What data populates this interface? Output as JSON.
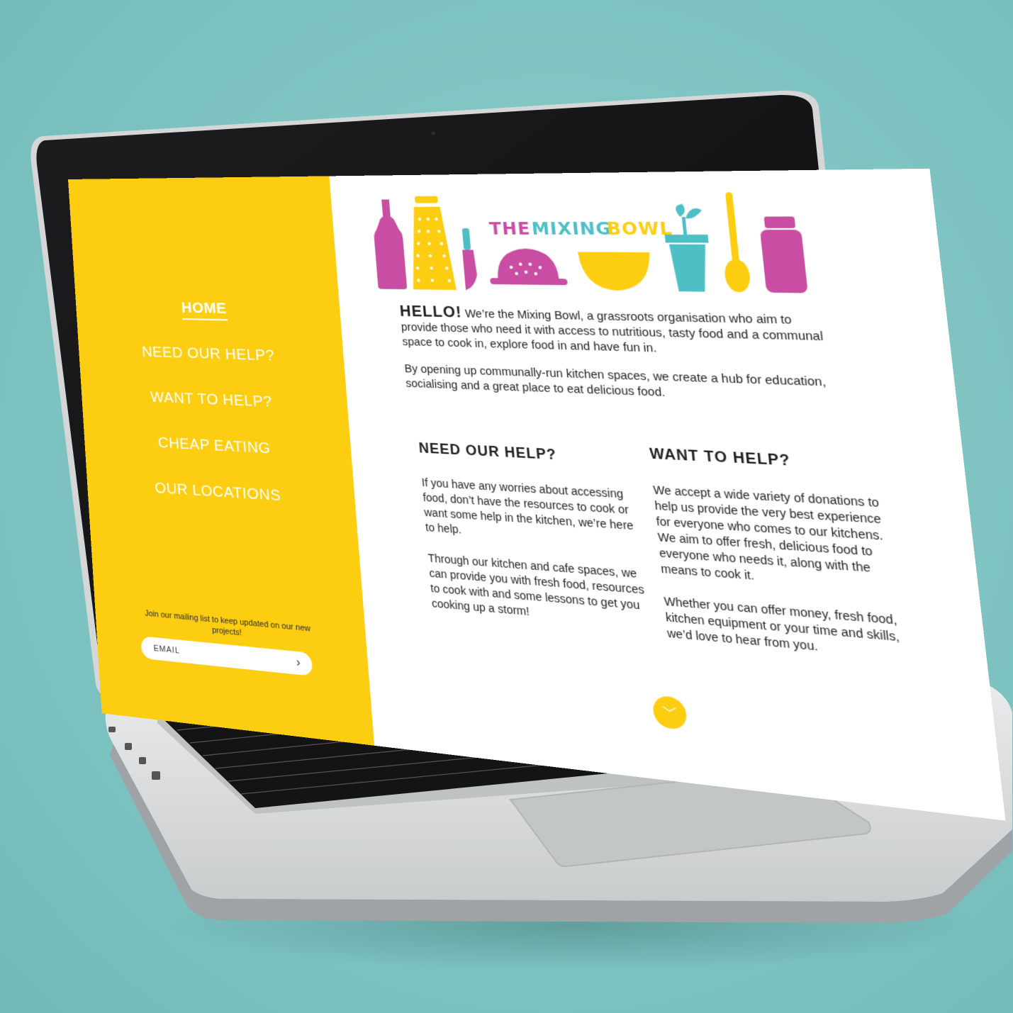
{
  "logo": {
    "word1": "THE",
    "word2": "MIXING",
    "word3": "BOWL"
  },
  "nav": {
    "items": [
      {
        "label": "HOME",
        "active": true
      },
      {
        "label": "NEED OUR HELP?",
        "active": false
      },
      {
        "label": "WANT TO HELP?",
        "active": false
      },
      {
        "label": "CHEAP EATING",
        "active": false
      },
      {
        "label": "OUR LOCATIONS",
        "active": false
      }
    ]
  },
  "mailing": {
    "text": "Join our mailing list to keep updated on our new projects!",
    "placeholder": "EMAIL",
    "submit_icon": "chevron-right-icon"
  },
  "intro": {
    "greeting": "HELLO!",
    "p1": "We’re the Mixing Bowl, a grassroots organisation who aim to provide those who need it with access to nutritious, tasty food and a communal space to cook in, explore food in and have fun in.",
    "p2": "By opening up communally-run kitchen spaces, we create a hub for education, socialising and a great place to eat delicious food."
  },
  "need_help": {
    "title": "NEED OUR HELP?",
    "p1": "If you have any worries about accessing food, don’t have the resources to cook or want some help in the kitchen, we’re here to help.",
    "p2": "Through our kitchen and cafe spaces, we can provide you with fresh food, resources to cook with and some lessons to get you cooking up a storm!"
  },
  "want_help": {
    "title": "WANT TO HELP?",
    "p1": "We accept a wide variety of donations to help us provide the very best experience for everyone who comes to our kitchens. We aim to offer fresh, delicious food to everyone who needs it, along with the means to cook it.",
    "p2": "Whether you can offer money, fresh food, kitchen equipment or your time and skills, we’d love to hear from you."
  },
  "scroll_icon": "chevron-down-icon",
  "colors": {
    "yellow": "#fdcd11",
    "pink": "#c94ea3",
    "teal": "#4fbfc6",
    "background": "#7fc4c2"
  }
}
